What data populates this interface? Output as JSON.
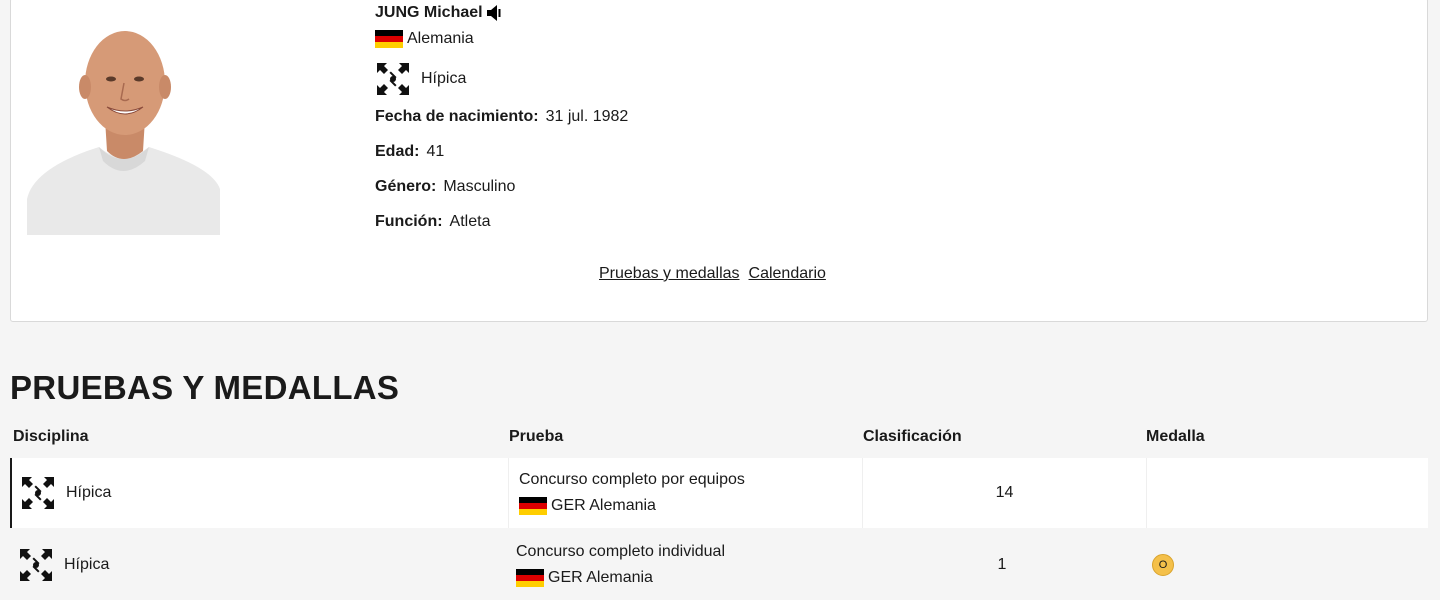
{
  "athlete": {
    "name": "JUNG Michael",
    "country": "Alemania",
    "sport": "Hípica",
    "fields": [
      {
        "label": "Fecha de nacimiento:",
        "value": "31 jul. 1982"
      },
      {
        "label": "Edad:",
        "value": "41"
      },
      {
        "label": "Género:",
        "value": "Masculino"
      },
      {
        "label": "Función:",
        "value": "Atleta"
      }
    ],
    "icons": {
      "audio": "speaker-icon",
      "flag": "germany-flag-icon",
      "sport": "equestrian-icon"
    }
  },
  "links": {
    "pruebas": "Pruebas y medallas",
    "calendario": "Calendario"
  },
  "section": {
    "title": "PRUEBAS Y MEDALLAS"
  },
  "table": {
    "headers": {
      "disciplina": "Disciplina",
      "prueba": "Prueba",
      "clasificacion": "Clasificación",
      "medalla": "Medalla"
    },
    "rows": [
      {
        "disciplina": "Hípica",
        "prueba": "Concurso completo por equipos",
        "team": "GER Alemania",
        "clasificacion": "14",
        "medalla": ""
      },
      {
        "disciplina": "Hípica",
        "prueba": "Concurso completo individual",
        "team": "GER Alemania",
        "clasificacion": "1",
        "medalla": "O"
      }
    ]
  },
  "colors": {
    "flag_black": "#000000",
    "flag_red": "#dd0000",
    "flag_gold": "#ffce00",
    "gold_medal": "#f4c04a"
  }
}
